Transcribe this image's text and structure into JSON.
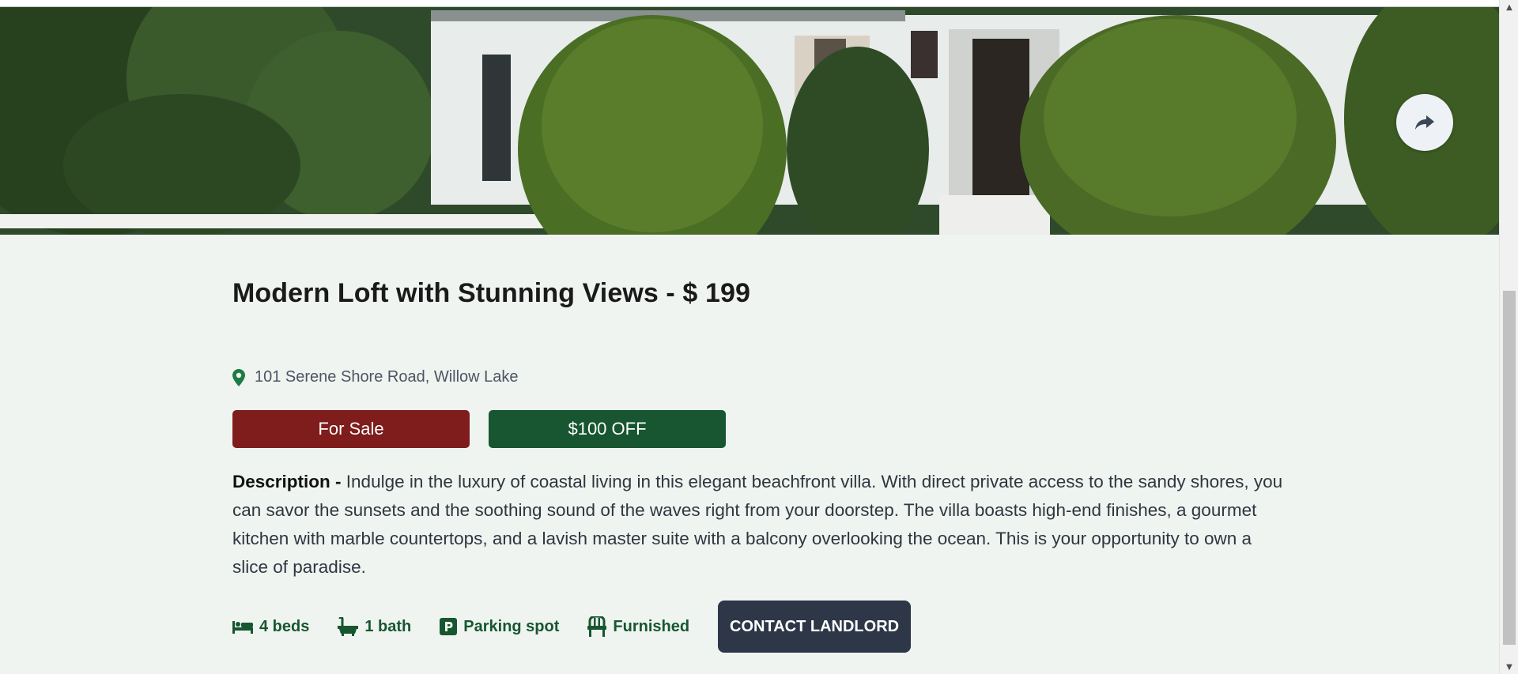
{
  "hero": {
    "image_alt": "House with hedges"
  },
  "share_button": {
    "icon": "share-icon"
  },
  "listing": {
    "title": "Modern Loft with Stunning Views - $ 199",
    "address": "101 Serene Shore Road, Willow Lake",
    "status_badge": "For Sale",
    "discount_badge": "$100 OFF",
    "description_label": "Description -",
    "description": "Indulge in the luxury of coastal living in this elegant beachfront villa. With direct private access to the sandy shores, you can savor the sunsets and the soothing sound of the waves right from your doorstep. The villa boasts high-end finishes, a gourmet kitchen with marble countertops, and a lavish master suite with a balcony overlooking the ocean. This is your opportunity to own a slice of paradise."
  },
  "amenities": {
    "beds": "4 beds",
    "bath": "1 bath",
    "parking": "Parking spot",
    "furnished": "Furnished"
  },
  "contact_button": "CONTACT LANDLORD",
  "colors": {
    "background": "#eff4f0",
    "sale_badge": "#7f1c1c",
    "discount_badge": "#175630",
    "amenity_text": "#175630",
    "contact_button": "#2d3748"
  }
}
